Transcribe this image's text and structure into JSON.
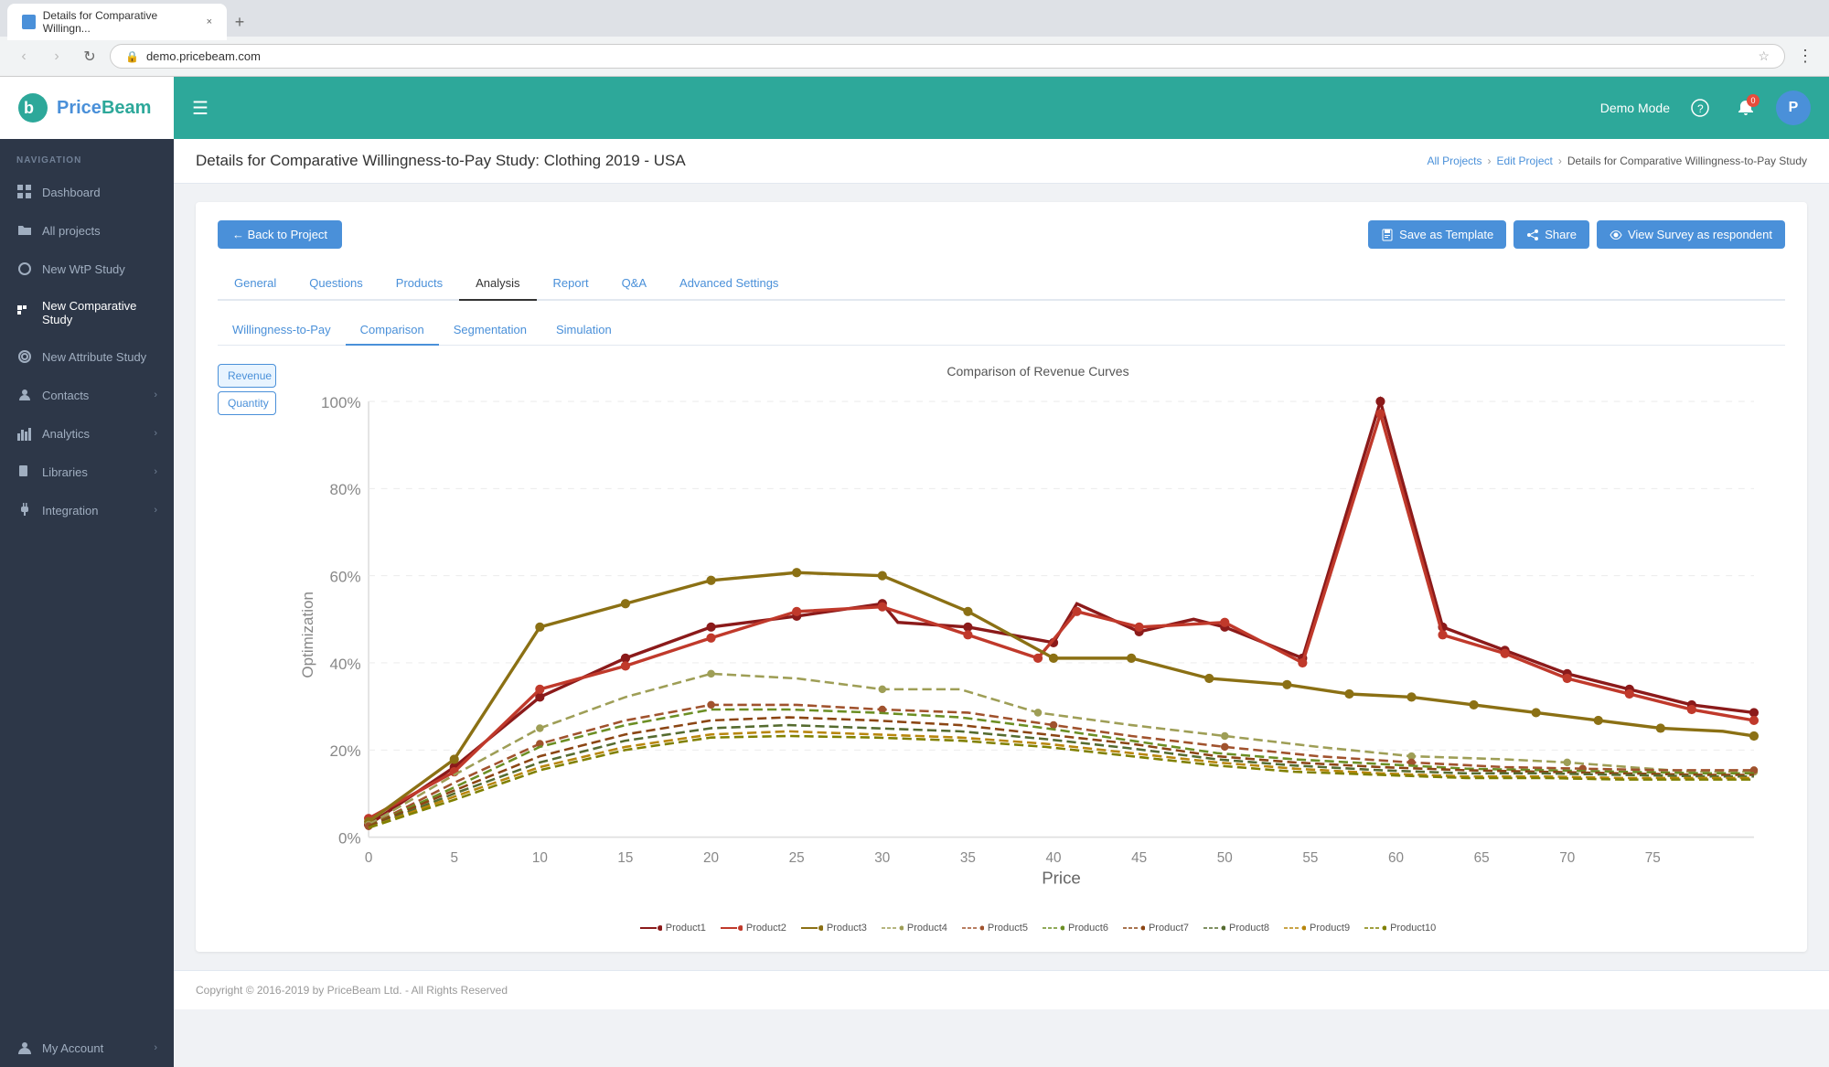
{
  "browser": {
    "tab_title": "Details for Comparative Willingn...",
    "tab_close": "×",
    "tab_new": "+",
    "address": "demo.pricebeam.com",
    "nav": {
      "back": "‹",
      "forward": "›",
      "reload": "↻"
    }
  },
  "header": {
    "hamburger": "☰",
    "demo_mode_label": "Demo Mode",
    "notification_count": "0",
    "avatar_letter": "P"
  },
  "sidebar": {
    "nav_label": "NAVIGATION",
    "logo_blue": "price",
    "logo_teal": "Beam",
    "items": [
      {
        "id": "dashboard",
        "label": "Dashboard",
        "icon": "grid",
        "has_arrow": false
      },
      {
        "id": "all-projects",
        "label": "All projects",
        "icon": "folder",
        "has_arrow": false
      },
      {
        "id": "new-wtp",
        "label": "New WtP Study",
        "icon": "circle",
        "has_arrow": false
      },
      {
        "id": "new-comparative",
        "label": "New Comparative Study",
        "icon": "grid-small",
        "has_arrow": false
      },
      {
        "id": "new-attribute",
        "label": "New Attribute Study",
        "icon": "circle-small",
        "has_arrow": false
      },
      {
        "id": "contacts",
        "label": "Contacts",
        "icon": "person",
        "has_arrow": true
      },
      {
        "id": "analytics",
        "label": "Analytics",
        "icon": "bar-chart",
        "has_arrow": true
      },
      {
        "id": "libraries",
        "label": "Libraries",
        "icon": "book",
        "has_arrow": true
      },
      {
        "id": "integration",
        "label": "Integration",
        "icon": "plug",
        "has_arrow": true
      },
      {
        "id": "my-account",
        "label": "My Account",
        "icon": "user",
        "has_arrow": true
      }
    ]
  },
  "breadcrumb": {
    "items": [
      "All Projects",
      "Edit Project",
      "Details for Comparative Willingness-to-Pay Study"
    ]
  },
  "page_title": "Details for Comparative Willingness-to-Pay Study: Clothing 2019 - USA",
  "toolbar": {
    "back_label": "← Back to Project",
    "save_template_label": "Save as Template",
    "share_label": "Share",
    "view_survey_label": "View Survey as respondent"
  },
  "tabs": {
    "main": [
      "General",
      "Questions",
      "Products",
      "Analysis",
      "Report",
      "Q&A",
      "Advanced Settings"
    ],
    "active_main": "Analysis",
    "sub": [
      "Willingness-to-Pay",
      "Comparison",
      "Segmentation",
      "Simulation"
    ],
    "active_sub": "Comparison"
  },
  "chart": {
    "title": "Comparison of Revenue Curves",
    "filters": [
      "Revenue",
      "Quantity"
    ],
    "active_filter": "Revenue",
    "x_label": "Price",
    "y_label": "Optimization",
    "y_ticks": [
      "100%",
      "80%",
      "60%",
      "40%",
      "20%",
      "0%"
    ],
    "x_ticks": [
      "0",
      "5",
      "10",
      "15",
      "20",
      "25",
      "30",
      "35",
      "40",
      "45",
      "50",
      "55",
      "60",
      "65",
      "70",
      "75"
    ],
    "legend": [
      {
        "id": "p1",
        "label": "Product1",
        "color": "#8b1a1a",
        "style": "solid"
      },
      {
        "id": "p2",
        "label": "Product2",
        "color": "#c0392b",
        "style": "solid"
      },
      {
        "id": "p3",
        "label": "Product3",
        "color": "#8b6914",
        "style": "solid"
      },
      {
        "id": "p4",
        "label": "Product4",
        "color": "#9e9e56",
        "style": "dashed"
      },
      {
        "id": "p5",
        "label": "Product5",
        "color": "#a0522d",
        "style": "dashed"
      },
      {
        "id": "p6",
        "label": "Product6",
        "color": "#6b8e23",
        "style": "dashed"
      },
      {
        "id": "p7",
        "label": "Product7",
        "color": "#8b4513",
        "style": "dashed"
      },
      {
        "id": "p8",
        "label": "Product8",
        "color": "#556b2f",
        "style": "dashed"
      },
      {
        "id": "p9",
        "label": "Product9",
        "color": "#b8860b",
        "style": "dashed"
      },
      {
        "id": "p10",
        "label": "Product10",
        "color": "#808000",
        "style": "dashed"
      }
    ]
  },
  "footer": {
    "copyright": "Copyright © 2016-2019 by PriceBeam Ltd. - All Rights Reserved"
  }
}
